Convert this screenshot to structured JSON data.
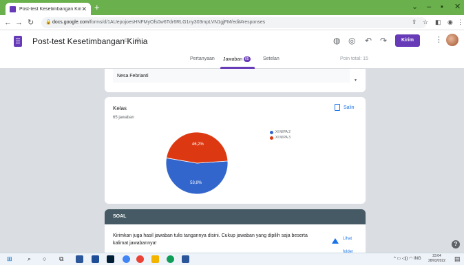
{
  "browser": {
    "tab_title": "Post-test Kesetimbangan Kimia",
    "url_host": "docs.google.com",
    "url_path": "/forms/d/1AUepojoesHNFMyOfs0w6Tdr6RLG1ny303mpLVN1gjFM/edit#responses"
  },
  "form": {
    "title": "Post-test Kesetimbangan Kimia",
    "send_label": "Kirim",
    "tabs": [
      {
        "label": "Pertanyaan"
      },
      {
        "label": "Jawaban",
        "badge": "65"
      },
      {
        "label": "Setelan"
      }
    ],
    "points_total": "Poin total: 15"
  },
  "previous_answer": {
    "value": "Nesa Febrianti"
  },
  "summary": {
    "question": "Kelas",
    "response_count": "65 jawaban",
    "copy_label": "Salin"
  },
  "chart_data": {
    "type": "pie",
    "categories": [
      "XI MIPA 2",
      "XI MIPA 3"
    ],
    "values": [
      53.8,
      46.2
    ],
    "data_labels": [
      "53,8%",
      "46,2%"
    ],
    "colors": [
      "#3366cc",
      "#dc3912"
    ],
    "legend_position": "right"
  },
  "section": {
    "title": "SOAL",
    "description": "Kirimkan juga hasil jawaban tulis tangannya disini. Cukup jawaban yang dipilih saja beserta kalimat jawabannya!",
    "folder_link": "Lihat folder"
  },
  "taskbar": {
    "time": "23:04",
    "date": "28/03/2022",
    "lang": "ING"
  }
}
